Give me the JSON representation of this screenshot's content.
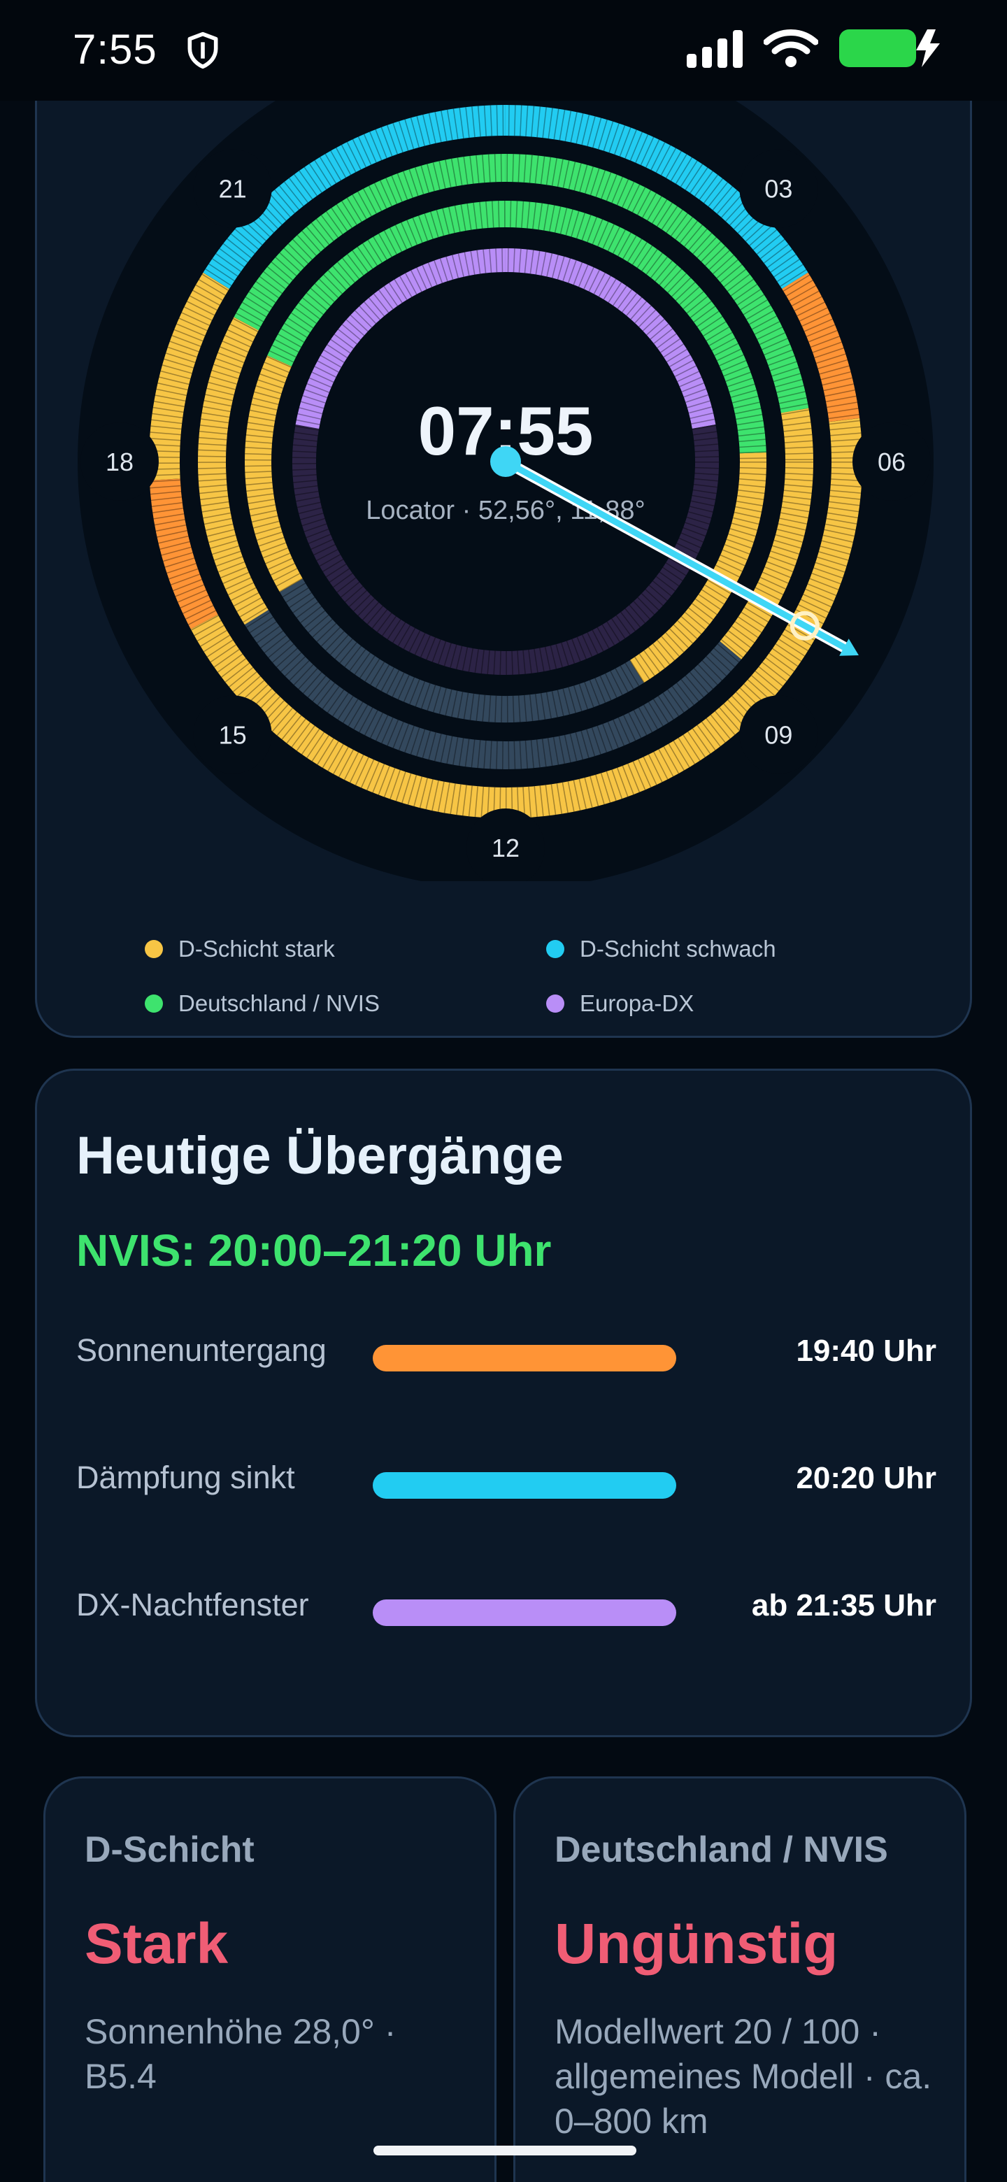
{
  "status_bar": {
    "time": "7:55",
    "icons": [
      "shield-icon",
      "signal-icon",
      "wifi-icon",
      "battery-charging-icon"
    ],
    "battery_color": "#2bd64a"
  },
  "dial": {
    "time": "07:55",
    "locator": "Locator · 52,56°, 11,88°",
    "hour_labels": [
      "21",
      "03",
      "18",
      "06",
      "15",
      "09",
      "12"
    ],
    "hand_color": "#3fd6f5"
  },
  "legend": {
    "items": [
      {
        "label": "D-Schicht stark",
        "color": "#f7c545"
      },
      {
        "label": "D-Schicht schwach",
        "color": "#22ccf2"
      },
      {
        "label": "Deutschland / NVIS",
        "color": "#3ee36e"
      },
      {
        "label": "Europa-DX",
        "color": "#b98ef7"
      }
    ]
  },
  "transitions": {
    "title": "Heutige Übergänge",
    "nvis": "NVIS: 20:00–21:20 Uhr",
    "rows": [
      {
        "label": "Sonnenuntergang",
        "value": "19:40 Uhr",
        "color": "#ff9436"
      },
      {
        "label": "Dämpfung sinkt",
        "value": "20:20 Uhr",
        "color": "#22ccf2"
      },
      {
        "label": "DX-Nachtfenster",
        "value": "ab 21:35 Uhr",
        "color": "#b98ef7"
      }
    ]
  },
  "cards": [
    {
      "title": "D-Schicht",
      "value": "Stark",
      "detail": "Sonnenhöhe 28,0° · B5.4"
    },
    {
      "title": "Deutschland / NVIS",
      "value": "Ungünstig",
      "detail": "Modellwert 20 / 100 · allgemeines Modell · ca. 0–800 km"
    }
  ]
}
